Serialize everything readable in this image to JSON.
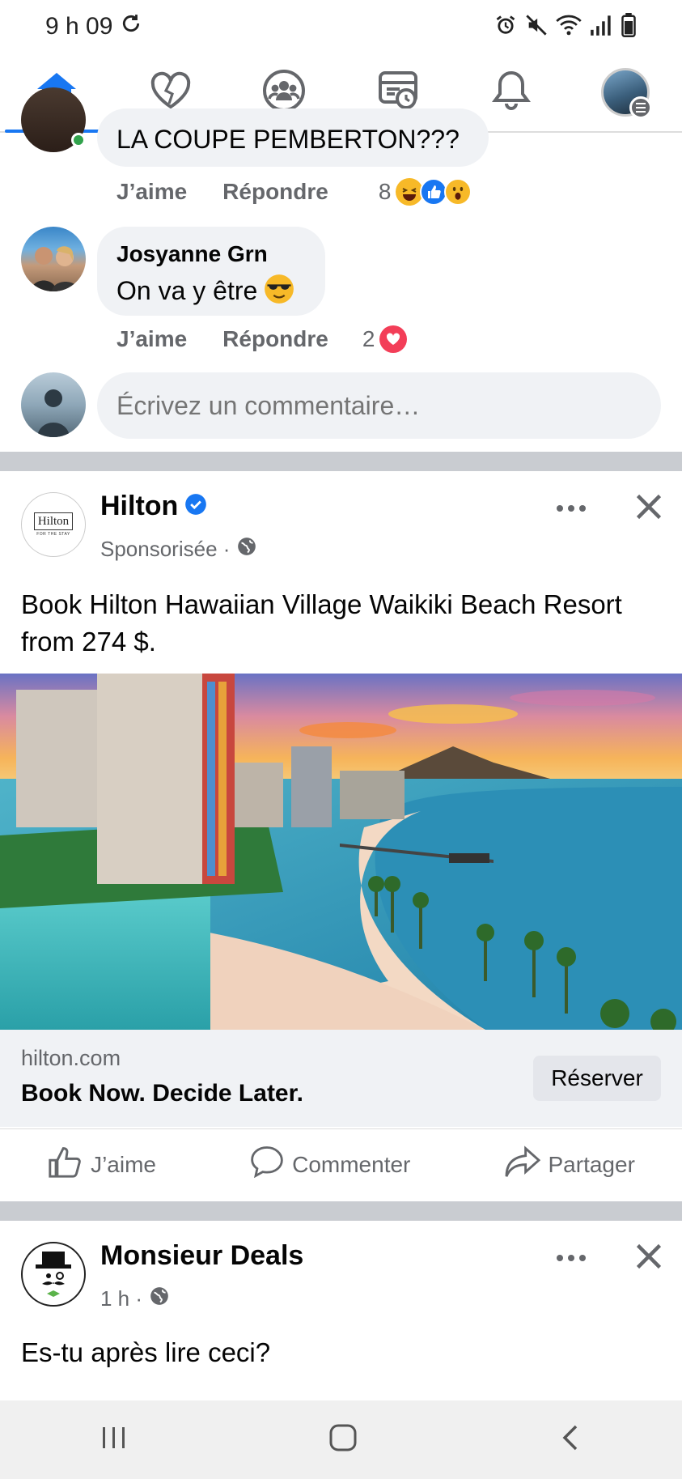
{
  "status_bar": {
    "time": "9 h 09"
  },
  "nav": {
    "tabs": [
      {
        "name": "home",
        "active": true
      },
      {
        "name": "dating"
      },
      {
        "name": "groups"
      },
      {
        "name": "memories"
      },
      {
        "name": "notifications"
      },
      {
        "name": "menu"
      }
    ]
  },
  "comments": {
    "partial": {
      "text": "LA COUPE PEMBERTON???",
      "like_label": "J’aime",
      "reply_label": "Répondre",
      "reaction_count": "8"
    },
    "second": {
      "author": "Josyanne Grn",
      "text": "On va y être",
      "like_label": "J’aime",
      "reply_label": "Répondre",
      "reaction_count": "2"
    },
    "composer": {
      "placeholder": "Écrivez un commentaire…"
    }
  },
  "sponsored_post": {
    "author": "Hilton",
    "logo_text": "Hilton",
    "logo_subtext": "FOR THE STAY",
    "meta": "Sponsorisée ·",
    "text": "Book Hilton Hawaiian Village Waikiki Beach Resort from 274 $.",
    "link": {
      "domain": "hilton.com",
      "title": "Book Now. Decide Later.",
      "cta": "Réserver"
    },
    "actions": {
      "like": "J’aime",
      "comment": "Commenter",
      "share": "Partager"
    }
  },
  "next_post": {
    "author": "Monsieur Deals",
    "meta": "1 h ·",
    "text": "Es-tu après lire ceci?"
  },
  "colors": {
    "accent": "#1877f2",
    "muted": "#65676b",
    "bubble": "#f0f2f5",
    "divider": "#c9ccd1"
  }
}
